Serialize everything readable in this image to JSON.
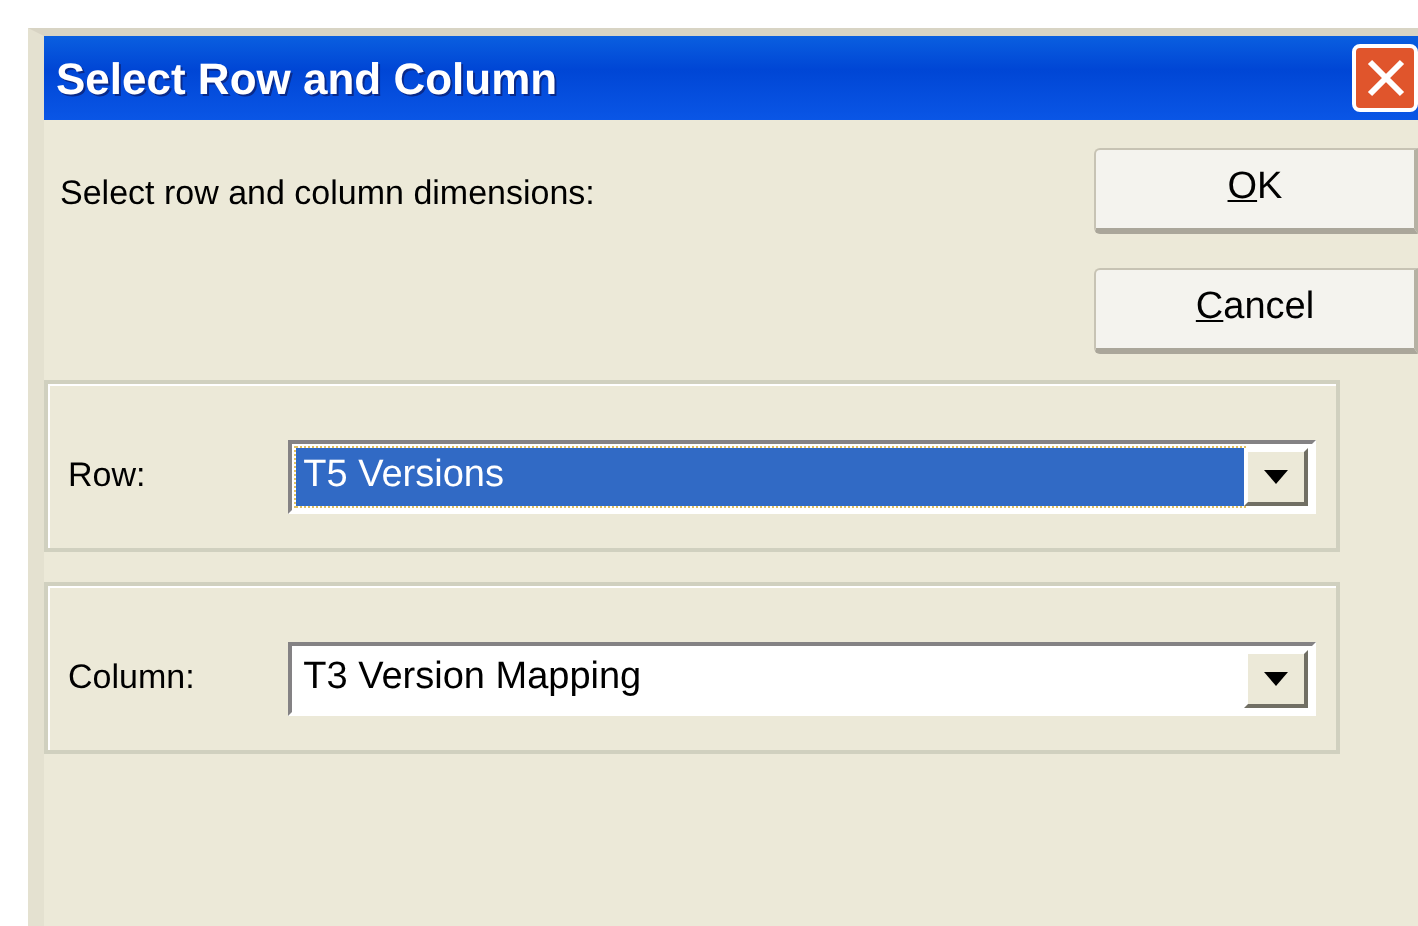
{
  "window": {
    "title": "Select Row and Column"
  },
  "prompt": "Select row and column dimensions:",
  "buttons": [
    {
      "label": "OK",
      "mnemonic_underlined": true
    },
    {
      "label": "Cancel",
      "mnemonic_underlined": true
    }
  ],
  "fields": [
    {
      "label": "Row:",
      "value": "T5 Versions",
      "focused": true
    },
    {
      "label": "Column:",
      "value": "T3 Version Mapping",
      "focused": false
    }
  ]
}
